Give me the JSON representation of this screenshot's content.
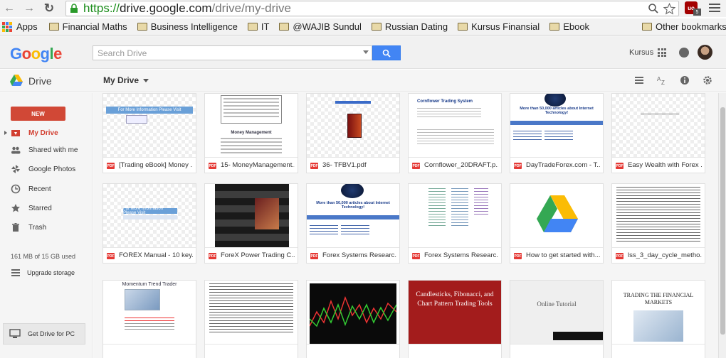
{
  "browser": {
    "url_scheme": "https://",
    "url_host": "drive.google.com",
    "url_path": "/drive/my-drive",
    "extension_label": "uo",
    "extension_badge": "5"
  },
  "bookmarks": {
    "apps_label": "Apps",
    "items": [
      "Financial Maths",
      "Business Intelligence",
      "IT",
      "@WAJIB Sundul",
      "Russian Dating",
      "Kursus Finansial",
      "Ebook"
    ],
    "other": "Other bookmarks"
  },
  "header": {
    "logo": "Google",
    "search_placeholder": "Search Drive",
    "account_name": "Kursus"
  },
  "subheader": {
    "app_name": "Drive",
    "title": "My Drive"
  },
  "sidebar": {
    "new_label": "NEW",
    "items": [
      {
        "label": "My Drive",
        "icon": "drive-folder-icon"
      },
      {
        "label": "Shared with me",
        "icon": "people-icon"
      },
      {
        "label": "Google Photos",
        "icon": "pinwheel-icon"
      },
      {
        "label": "Recent",
        "icon": "clock-icon"
      },
      {
        "label": "Starred",
        "icon": "star-icon"
      },
      {
        "label": "Trash",
        "icon": "trash-icon"
      }
    ],
    "storage": "161 MB of 15 GB used",
    "upgrade": "Upgrade storage",
    "get_drive": "Get Drive for PC"
  },
  "files": [
    {
      "name": "[Trading eBook] Money ...",
      "type": "pdf",
      "thumb": "banner",
      "banner_text": "For More Information Please Visit"
    },
    {
      "name": "15- MoneyManagement...",
      "type": "pdf",
      "thumb": "doc",
      "heading": "Money Management"
    },
    {
      "name": "36- TFBV1.pdf",
      "type": "pdf",
      "thumb": "book"
    },
    {
      "name": "Cornflower_20DRAFT.p...",
      "type": "pdf",
      "thumb": "doc",
      "heading": "Cornflower Trading System"
    },
    {
      "name": "DayTradeForex.com - T...",
      "type": "pdf",
      "thumb": "internet",
      "heading": "More than 50,000 articles about Internet Technology!"
    },
    {
      "name": "Easy Wealth with Forex ...",
      "type": "pdf",
      "thumb": "checker"
    },
    {
      "name": "FOREX Manual - 10 key...",
      "type": "pdf",
      "thumb": "banner",
      "banner_text": "For More Information Please Visit"
    },
    {
      "name": "ForeX Power Trading C...",
      "type": "pdf",
      "thumb": "collage"
    },
    {
      "name": "Forex Systems Researc...",
      "type": "pdf",
      "thumb": "internet",
      "heading": "More than 50,000 articles about Internet Technology!"
    },
    {
      "name": "Forex Systems Researc...",
      "type": "pdf",
      "thumb": "table"
    },
    {
      "name": "How to get started with...",
      "type": "pdf",
      "thumb": "drive"
    },
    {
      "name": "lss_3_day_cycle_metho...",
      "type": "pdf",
      "thumb": "text"
    },
    {
      "name": "",
      "type": "pdf",
      "thumb": "doc",
      "heading": "Momentum Trend Trader"
    },
    {
      "name": "",
      "type": "pdf",
      "thumb": "text"
    },
    {
      "name": "",
      "type": "pdf",
      "thumb": "chart"
    },
    {
      "name": "",
      "type": "pdf",
      "thumb": "cover",
      "heading": "Candlesticks, Fibonacci, and Chart Pattern Trading Tools"
    },
    {
      "name": "",
      "type": "pdf",
      "thumb": "tutorial",
      "heading": "Online Tutorial"
    },
    {
      "name": "",
      "type": "pdf",
      "thumb": "markets",
      "heading": "TRADING THE FINANCIAL MARKETS"
    }
  ],
  "colors": {
    "accent": "#4285f4",
    "new_button": "#d14836",
    "active_nav": "#d23f31",
    "pdf_badge": "#e53935"
  }
}
